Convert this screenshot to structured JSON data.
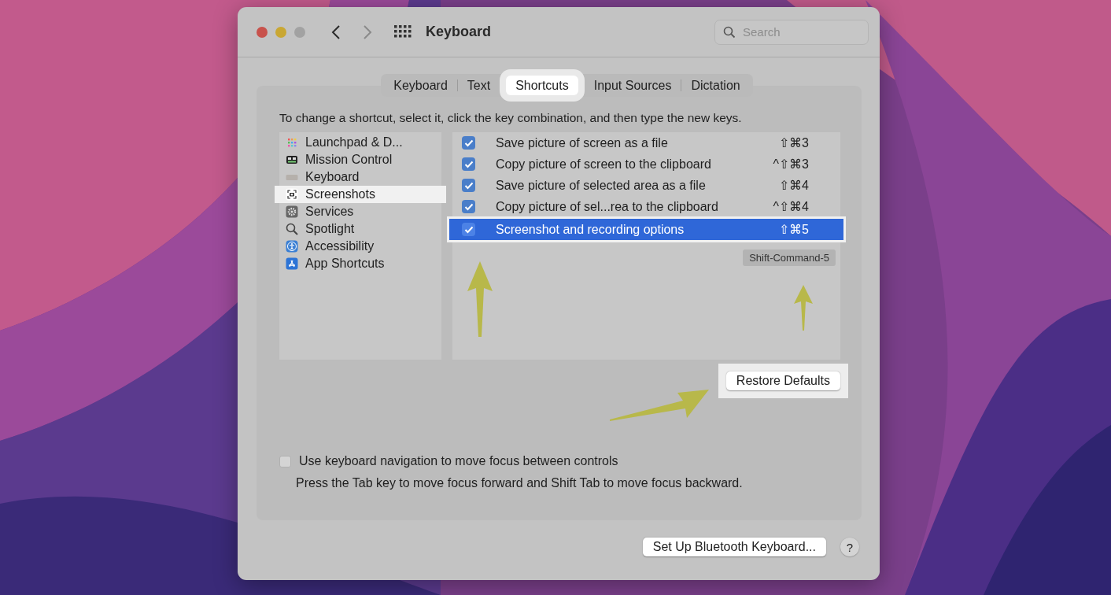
{
  "window": {
    "title": "Keyboard",
    "search": {
      "placeholder": "Search"
    }
  },
  "tabs": [
    {
      "label": "Keyboard",
      "selected": false
    },
    {
      "label": "Text",
      "selected": false
    },
    {
      "label": "Shortcuts",
      "selected": true
    },
    {
      "label": "Input Sources",
      "selected": false
    },
    {
      "label": "Dictation",
      "selected": false
    }
  ],
  "instruction": "To change a shortcut, select it, click the key combination, and then type the new keys.",
  "categories": [
    {
      "label": "Launchpad & D...",
      "kind": "launchpad",
      "selected": false
    },
    {
      "label": "Mission Control",
      "kind": "mission",
      "selected": false
    },
    {
      "label": "Keyboard",
      "kind": "keyboard",
      "selected": false
    },
    {
      "label": "Screenshots",
      "kind": "screenshot",
      "selected": true
    },
    {
      "label": "Services",
      "kind": "gear",
      "selected": false
    },
    {
      "label": "Spotlight",
      "kind": "search",
      "selected": false
    },
    {
      "label": "Accessibility",
      "kind": "accessibility",
      "selected": false
    },
    {
      "label": "App Shortcuts",
      "kind": "appstore",
      "selected": false
    }
  ],
  "shortcuts": [
    {
      "label": "Save picture of screen as a file",
      "keys": "⇧⌘3",
      "checked": true,
      "selected": false
    },
    {
      "label": "Copy picture of screen to the clipboard",
      "keys": "^⇧⌘3",
      "checked": true,
      "selected": false
    },
    {
      "label": "Save picture of selected area as a file",
      "keys": "⇧⌘4",
      "checked": true,
      "selected": false
    },
    {
      "label": "Copy picture of sel...rea to the clipboard",
      "keys": "^⇧⌘4",
      "checked": true,
      "selected": false
    },
    {
      "label": "Screenshot and recording options",
      "keys": "⇧⌘5",
      "checked": true,
      "selected": true
    }
  ],
  "tooltip": "Shift-Command-5",
  "restore_button": {
    "label": "Restore Defaults",
    "highlighted": true
  },
  "keyboard_navigation": {
    "label": "Use keyboard navigation to move focus between controls",
    "checked": false,
    "hint": "Press the Tab key to move focus forward and Shift Tab to move focus backward."
  },
  "bluetooth_button": "Set Up Bluetooth Keyboard...",
  "help_button": "?"
}
